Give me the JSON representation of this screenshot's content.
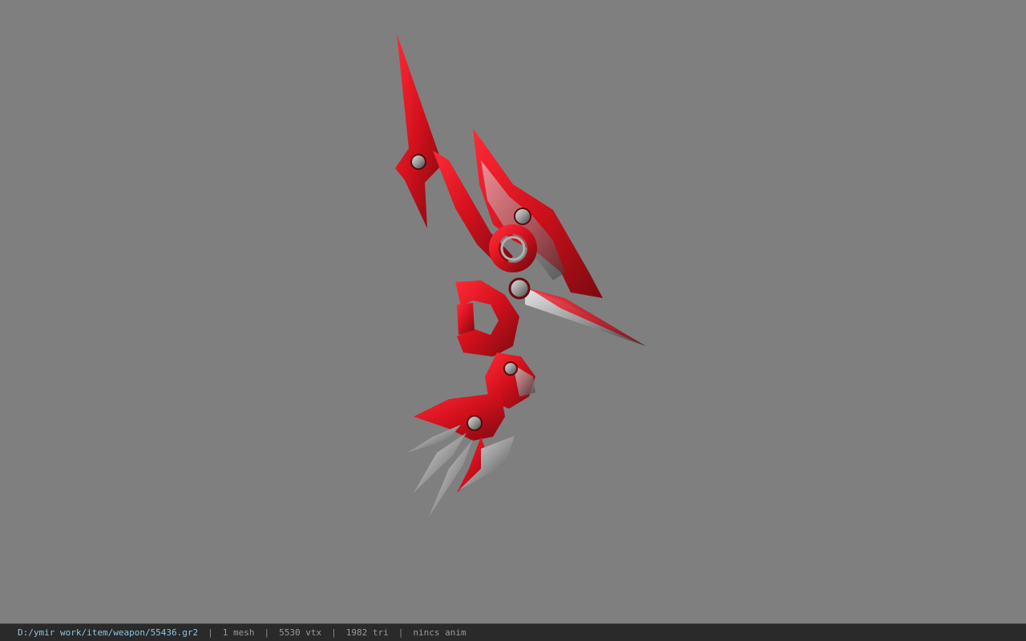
{
  "viewer": {
    "background_color": "#7f7f7f",
    "model_colors": {
      "primary_red": "#d0101c",
      "dark_red": "#7a0a10",
      "metal_light": "#c8c8c8",
      "metal_dark": "#4a4a4a"
    },
    "model_icon": "red-spiked-staff-weapon-model"
  },
  "status": {
    "path": "D:/ymir work/item/weapon/55436.gr2",
    "separator": "|",
    "mesh": "1 mesh",
    "vtx": "5530 vtx",
    "tri": "1982 tri",
    "anim": "nincs anim"
  }
}
